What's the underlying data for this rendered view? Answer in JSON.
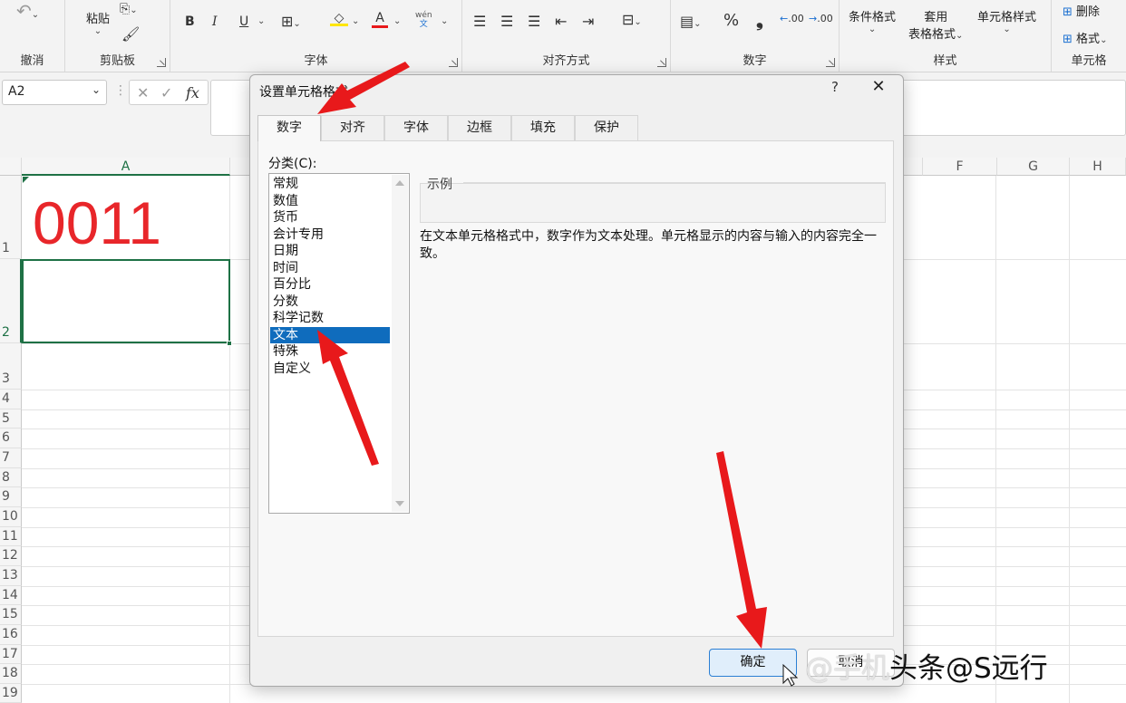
{
  "ribbon": {
    "groups": {
      "undo": "撤消",
      "clipboard": "剪贴板",
      "font": "字体",
      "alignment": "对齐方式",
      "number": "数字",
      "styles": "样式",
      "cells": "单元格"
    },
    "paste_label": "粘贴",
    "bold": "B",
    "italic": "I",
    "underline": "U",
    "font_color_letter": "A",
    "pinyin_top": "wén",
    "pinyin_bottom": "文",
    "percent": "%",
    "comma": "❟",
    "increase_decimal": ".00",
    "decrease_decimal": ".00",
    "conditional_format": "条件格式",
    "format_as_table_line1": "套用",
    "format_as_table_line2": "表格格式",
    "cell_styles": "单元格样式",
    "delete": "删除",
    "format": "格式"
  },
  "formula_bar": {
    "name_box": "A2",
    "cancel_symbol": "✕",
    "enter_symbol": "✓",
    "fx": "fx"
  },
  "grid": {
    "columns": [
      "A",
      "F",
      "G",
      "H"
    ],
    "rows": [
      "1",
      "2",
      "3",
      "4",
      "5",
      "6",
      "7",
      "8",
      "9",
      "10",
      "11",
      "12",
      "13",
      "14",
      "15",
      "16",
      "17",
      "18",
      "19"
    ],
    "cell_a1": "0011"
  },
  "dialog": {
    "title": "设置单元格格式",
    "help": "?",
    "close": "✕",
    "tabs": [
      "数字",
      "对齐",
      "字体",
      "边框",
      "填充",
      "保护"
    ],
    "category_label": "分类(C):",
    "categories": [
      "常规",
      "数值",
      "货币",
      "会计专用",
      "日期",
      "时间",
      "百分比",
      "分数",
      "科学记数",
      "文本",
      "特殊",
      "自定义"
    ],
    "selected_category": "文本",
    "sample_label": "示例",
    "description": "在文本单元格格式中，数字作为文本处理。单元格显示的内容与输入的内容完全一致。",
    "ok": "确定",
    "cancel": "取消"
  },
  "watermark": {
    "prefix": "@手机",
    "text": "头条@S远行"
  },
  "colors": {
    "accent_blue": "#0f6cbd",
    "excel_green": "#1e7145",
    "cell_text_red": "#e8262a",
    "annotation_red": "#e8191b"
  }
}
